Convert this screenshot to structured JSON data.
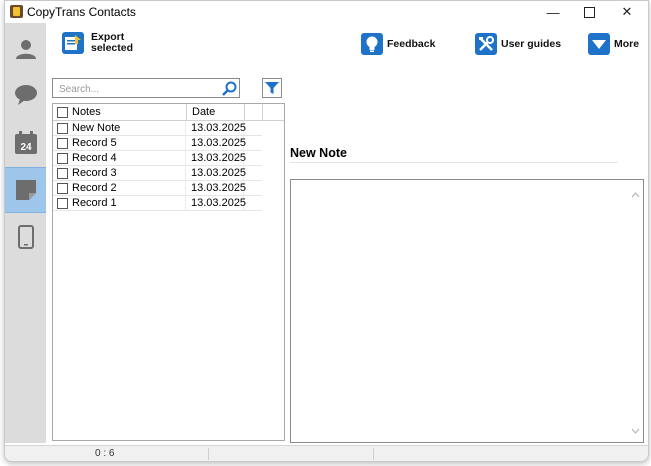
{
  "window": {
    "title": "CopyTrans Contacts",
    "controls": {
      "minimize": "—",
      "close": "✕"
    }
  },
  "sidebar": {
    "items": [
      {
        "icon": "contacts-icon",
        "active": false
      },
      {
        "icon": "messages-icon",
        "active": false
      },
      {
        "icon": "calendar-icon",
        "label": "24",
        "active": false
      },
      {
        "icon": "notes-icon",
        "active": true
      },
      {
        "icon": "phone-icon",
        "active": false
      }
    ]
  },
  "toolbar": {
    "export_label_line1": "Export",
    "export_label_line2": "selected",
    "feedback_label": "Feedback",
    "user_guides_label": "User guides",
    "more_label": "More",
    "accent": "#1e73c8"
  },
  "search": {
    "placeholder": "Search..."
  },
  "notes_list": {
    "columns": {
      "notes": "Notes",
      "date": "Date"
    },
    "rows": [
      {
        "name": "New Note",
        "date": "13.03.2025"
      },
      {
        "name": "Record 5",
        "date": "13.03.2025"
      },
      {
        "name": "Record 4",
        "date": "13.03.2025"
      },
      {
        "name": "Record 3",
        "date": "13.03.2025"
      },
      {
        "name": "Record 2",
        "date": "13.03.2025"
      },
      {
        "name": "Record 1",
        "date": "13.03.2025"
      }
    ]
  },
  "detail": {
    "title": "New Note",
    "body": ""
  },
  "status": {
    "count": "0 : 6"
  }
}
